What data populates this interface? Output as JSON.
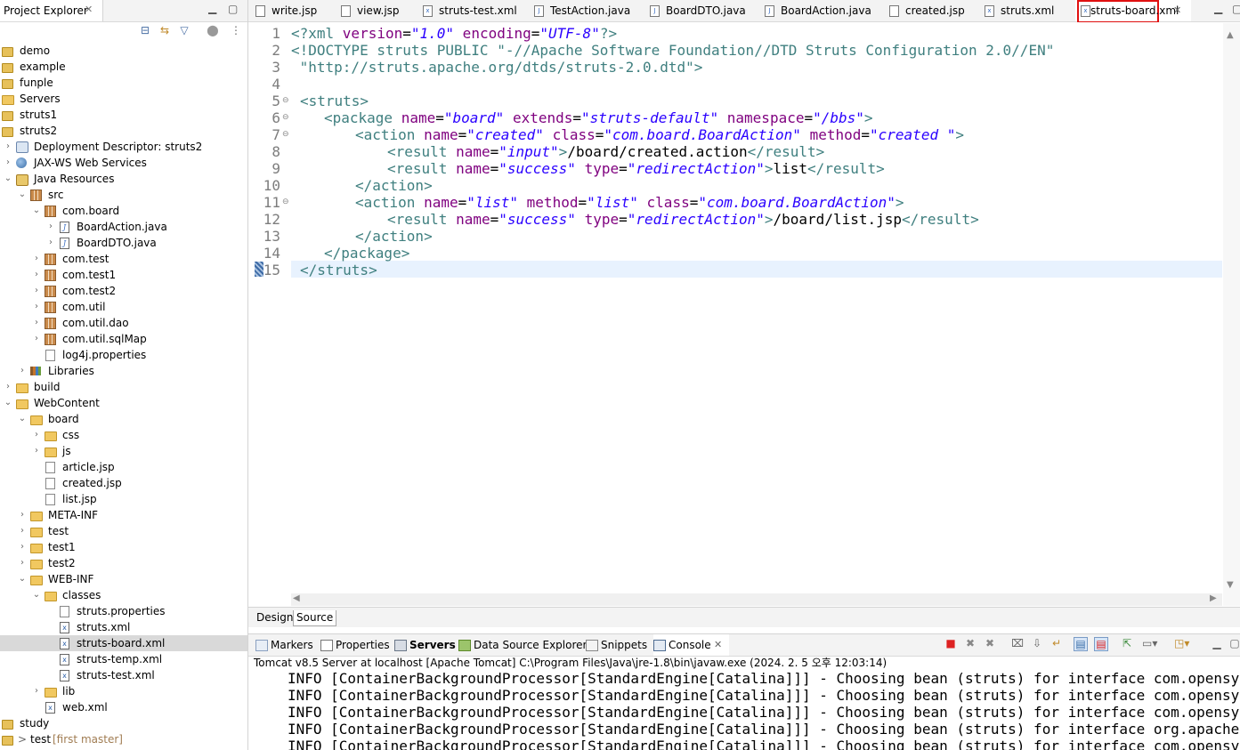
{
  "project_explorer": {
    "title": "Project Explorer",
    "items": [
      {
        "label": "demo"
      },
      {
        "label": "example"
      },
      {
        "label": "funple"
      },
      {
        "label": "Servers"
      },
      {
        "label": "struts1"
      },
      {
        "label": "struts2"
      },
      {
        "label": "Deployment Descriptor: struts2"
      },
      {
        "label": "JAX-WS Web Services"
      },
      {
        "label": "Java Resources"
      },
      {
        "label": "src"
      },
      {
        "label": "com.board"
      },
      {
        "label": "BoardAction.java"
      },
      {
        "label": "BoardDTO.java"
      },
      {
        "label": "com.test"
      },
      {
        "label": "com.test1"
      },
      {
        "label": "com.test2"
      },
      {
        "label": "com.util"
      },
      {
        "label": "com.util.dao"
      },
      {
        "label": "com.util.sqlMap"
      },
      {
        "label": "log4j.properties"
      },
      {
        "label": "Libraries"
      },
      {
        "label": "build"
      },
      {
        "label": "WebContent"
      },
      {
        "label": "board"
      },
      {
        "label": "css"
      },
      {
        "label": "js"
      },
      {
        "label": "article.jsp"
      },
      {
        "label": "created.jsp"
      },
      {
        "label": "list.jsp"
      },
      {
        "label": "META-INF"
      },
      {
        "label": "test"
      },
      {
        "label": "test1"
      },
      {
        "label": "test2"
      },
      {
        "label": "WEB-INF"
      },
      {
        "label": "classes"
      },
      {
        "label": "struts.properties"
      },
      {
        "label": "struts.xml"
      },
      {
        "label": "struts-board.xml"
      },
      {
        "label": "struts-temp.xml"
      },
      {
        "label": "struts-test.xml"
      },
      {
        "label": "lib"
      },
      {
        "label": "web.xml"
      },
      {
        "label": "study"
      },
      {
        "label": "test",
        "git": "[first master]"
      }
    ]
  },
  "editor": {
    "tabs": [
      {
        "label": "write.jsp"
      },
      {
        "label": "view.jsp"
      },
      {
        "label": "struts-test.xml"
      },
      {
        "label": "TestAction.java"
      },
      {
        "label": "BoardDTO.java"
      },
      {
        "label": "BoardAction.java"
      },
      {
        "label": "created.jsp"
      },
      {
        "label": "struts.xml"
      },
      {
        "label": "struts-board.xml",
        "active": true
      }
    ],
    "line_numbers": [
      "1",
      "2",
      "3",
      "4",
      "5",
      "6",
      "7",
      "8",
      "9",
      "10",
      "11",
      "12",
      "13",
      "14",
      "15"
    ],
    "code": {
      "l1": {
        "a": "<?xml ",
        "b": "version",
        "c": "=",
        "d": "\"1.0\"",
        "e": " encoding",
        "f": "=",
        "g": "\"UTF-8\"",
        "h": "?>"
      },
      "l2": {
        "a": "<!DOCTYPE struts ",
        "b": "PUBLIC ",
        "c": "\"-//Apache Software Foundation//DTD Struts Configuration 2.0//EN\""
      },
      "l3": {
        "a": " \"http://struts.apache.org/dtds/struts-2.0.dtd\">"
      },
      "l5": {
        "a": "<struts>"
      },
      "l6": {
        "a": "<package ",
        "b": "name",
        "c": "=",
        "d": "\"board\"",
        "e": " extends",
        "f": "=",
        "g": "\"struts-default\"",
        "h": " namespace",
        "i": "=",
        "j": "\"/bbs\"",
        "k": ">"
      },
      "l7": {
        "a": "<action ",
        "b": "name",
        "c": "=",
        "d": "\"created\"",
        "e": " class",
        "f": "=",
        "g": "\"com.board.BoardAction\"",
        "h": " method",
        "i": "=",
        "j": "\"created \"",
        "k": ">"
      },
      "l8": {
        "a": "<result ",
        "b": "name",
        "c": "=",
        "d": "\"input\"",
        "e": ">",
        "f": "/board/created.action",
        "g": "</result>"
      },
      "l9": {
        "a": "<result ",
        "b": "name",
        "c": "=",
        "d": "\"success\"",
        "e": " type",
        "f": "=",
        "g": "\"redirectAction\"",
        "h": ">",
        "i": "list",
        "j": "</result>"
      },
      "l10": {
        "a": "</action>"
      },
      "l11": {
        "a": "<action ",
        "b": "name",
        "c": "=",
        "d": "\"list\"",
        "e": " method",
        "f": "=",
        "g": "\"list\"",
        "h": " class",
        "i": "=",
        "j": "\"com.board.BoardAction\"",
        "k": ">"
      },
      "l12": {
        "a": "<result ",
        "b": "name",
        "c": "=",
        "d": "\"success\"",
        "e": " type",
        "f": "=",
        "g": "\"redirectAction\"",
        "h": ">",
        "i": "/board/list.jsp",
        "j": "</result>"
      },
      "l13": {
        "a": "</action>"
      },
      "l14": {
        "a": "</package>"
      },
      "l15": {
        "a": "</struts>"
      }
    },
    "design_tab": "Design",
    "source_tab": "Source"
  },
  "console": {
    "tabs": [
      {
        "label": "Markers"
      },
      {
        "label": "Properties"
      },
      {
        "label": "Servers"
      },
      {
        "label": "Data Source Explorer"
      },
      {
        "label": "Snippets"
      },
      {
        "label": "Console"
      }
    ],
    "description": "Tomcat v8.5 Server at localhost [Apache Tomcat] C:\\Program Files\\Java\\jre-1.8\\bin\\javaw.exe  (2024. 2. 5 오후 12:03:14)",
    "lines": [
      "INFO [ContainerBackgroundProcessor[StandardEngine[Catalina]]] - Choosing bean (struts) for interface com.opensymphony.",
      "INFO [ContainerBackgroundProcessor[StandardEngine[Catalina]]] - Choosing bean (struts) for interface com.opensymphony.",
      "INFO [ContainerBackgroundProcessor[StandardEngine[Catalina]]] - Choosing bean (struts) for interface com.opensymphony.",
      "INFO [ContainerBackgroundProcessor[StandardEngine[Catalina]]] - Choosing bean (struts) for interface org.apache.struts",
      "INFO [ContainerBackgroundProcessor[StandardEngine[Catalina]]] - Choosing bean (struts) for interface com.opensymphony."
    ]
  },
  "colors": {
    "highlight_box": "#e01010",
    "tag": "#3f7f7f",
    "attribute_name": "#7f007f",
    "attribute_value": "#2a00ff",
    "current_line": "#e8f2fe",
    "selected_row": "#d9d9d9"
  }
}
